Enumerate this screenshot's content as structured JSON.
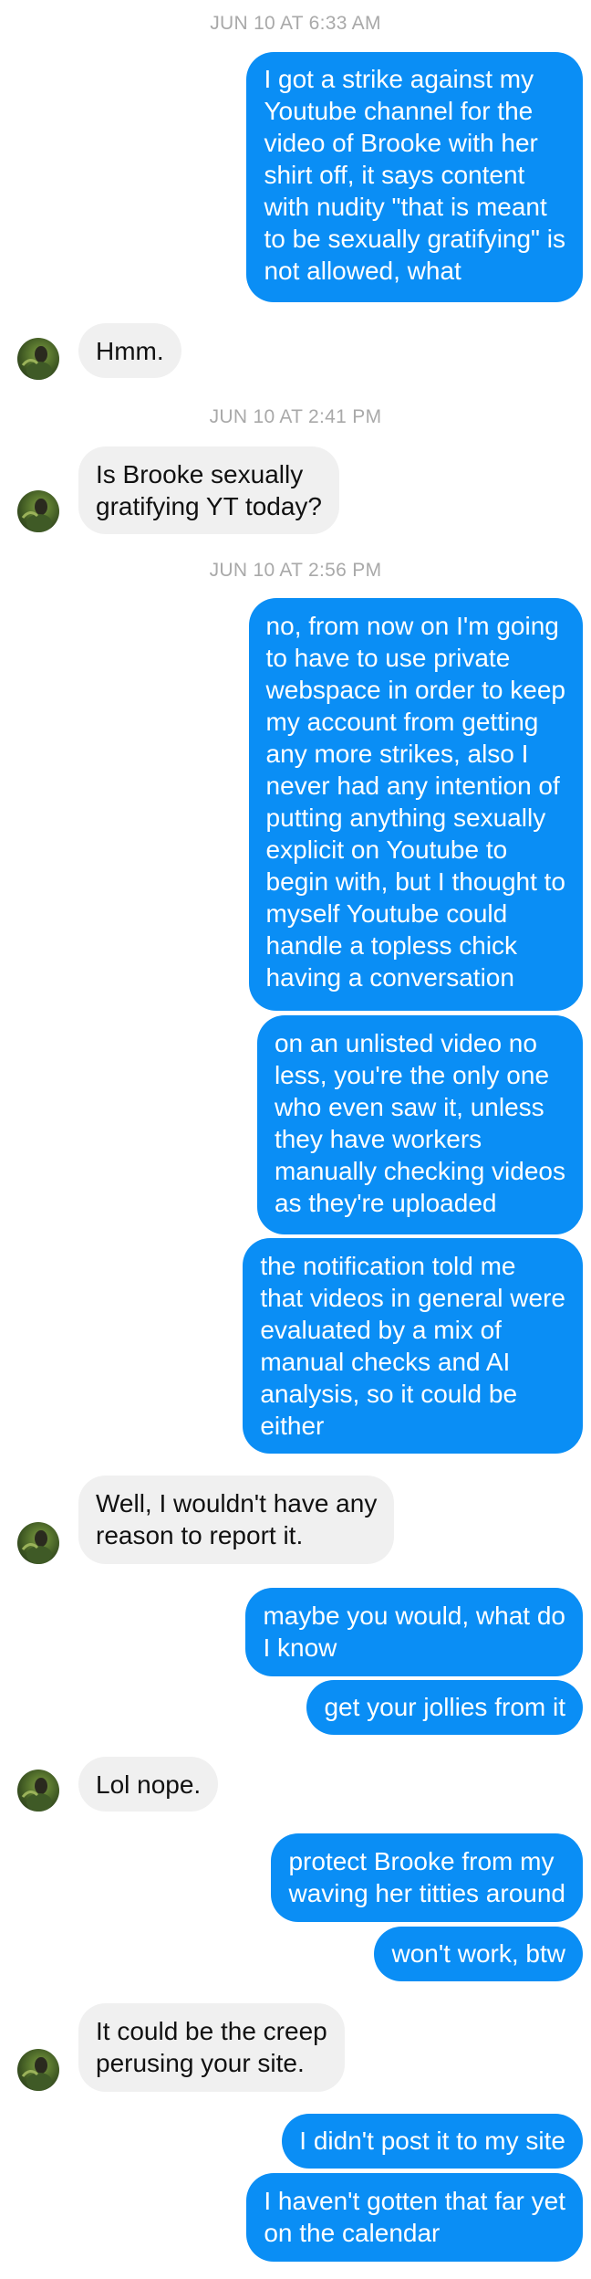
{
  "timestamps": [
    "JUN 10 AT 6:33 AM",
    "JUN 10 AT 2:41 PM",
    "JUN 10 AT 2:56 PM"
  ],
  "messages": [
    {
      "dir": "out",
      "text": "I got a strike against my\nYoutube channel for the\nvideo of Brooke with her\nshirt off, it says content\nwith nudity \"that is meant\nto be sexually gratifying\" is\nnot allowed, what"
    },
    {
      "dir": "in",
      "text": "Hmm."
    },
    {
      "dir": "in",
      "text": "Is Brooke sexually\ngratifying YT today?"
    },
    {
      "dir": "out",
      "text": "no, from now on I'm going\nto have to use private\nwebspace in order to keep\nmy account from getting\nany more strikes, also I\nnever had any intention of\nputting anything sexually\nexplicit on Youtube to\nbegin with, but I thought to\nmyself Youtube could\nhandle a topless chick\nhaving a conversation"
    },
    {
      "dir": "out",
      "text": "on an unlisted video no\nless, you're the only one\nwho even saw it, unless\nthey have workers\nmanually checking videos\nas they're uploaded"
    },
    {
      "dir": "out",
      "text": "the notification told me\nthat videos in general were\nevaluated by a mix of\nmanual checks and AI\nanalysis, so it could be\neither"
    },
    {
      "dir": "in",
      "text": "Well, I wouldn't have any\nreason to report it."
    },
    {
      "dir": "out",
      "text": "maybe you would, what do\nI know"
    },
    {
      "dir": "out",
      "text": "get your jollies from it"
    },
    {
      "dir": "in",
      "text": "Lol nope."
    },
    {
      "dir": "out",
      "text": "protect Brooke from my\nwaving her titties around"
    },
    {
      "dir": "out",
      "text": "won't work, btw"
    },
    {
      "dir": "in",
      "text": "It could be the creep\nperusing your site."
    },
    {
      "dir": "out",
      "text": "I didn't post it to my site"
    },
    {
      "dir": "out",
      "text": "I haven't gotten that far yet\non the calendar"
    }
  ],
  "colors": {
    "outgoing_bubble": "#0a8ef5",
    "incoming_bubble": "#f0f0f0",
    "timestamp": "#a9a9a9"
  },
  "icons": {
    "avatar": "contact-avatar-photo"
  }
}
